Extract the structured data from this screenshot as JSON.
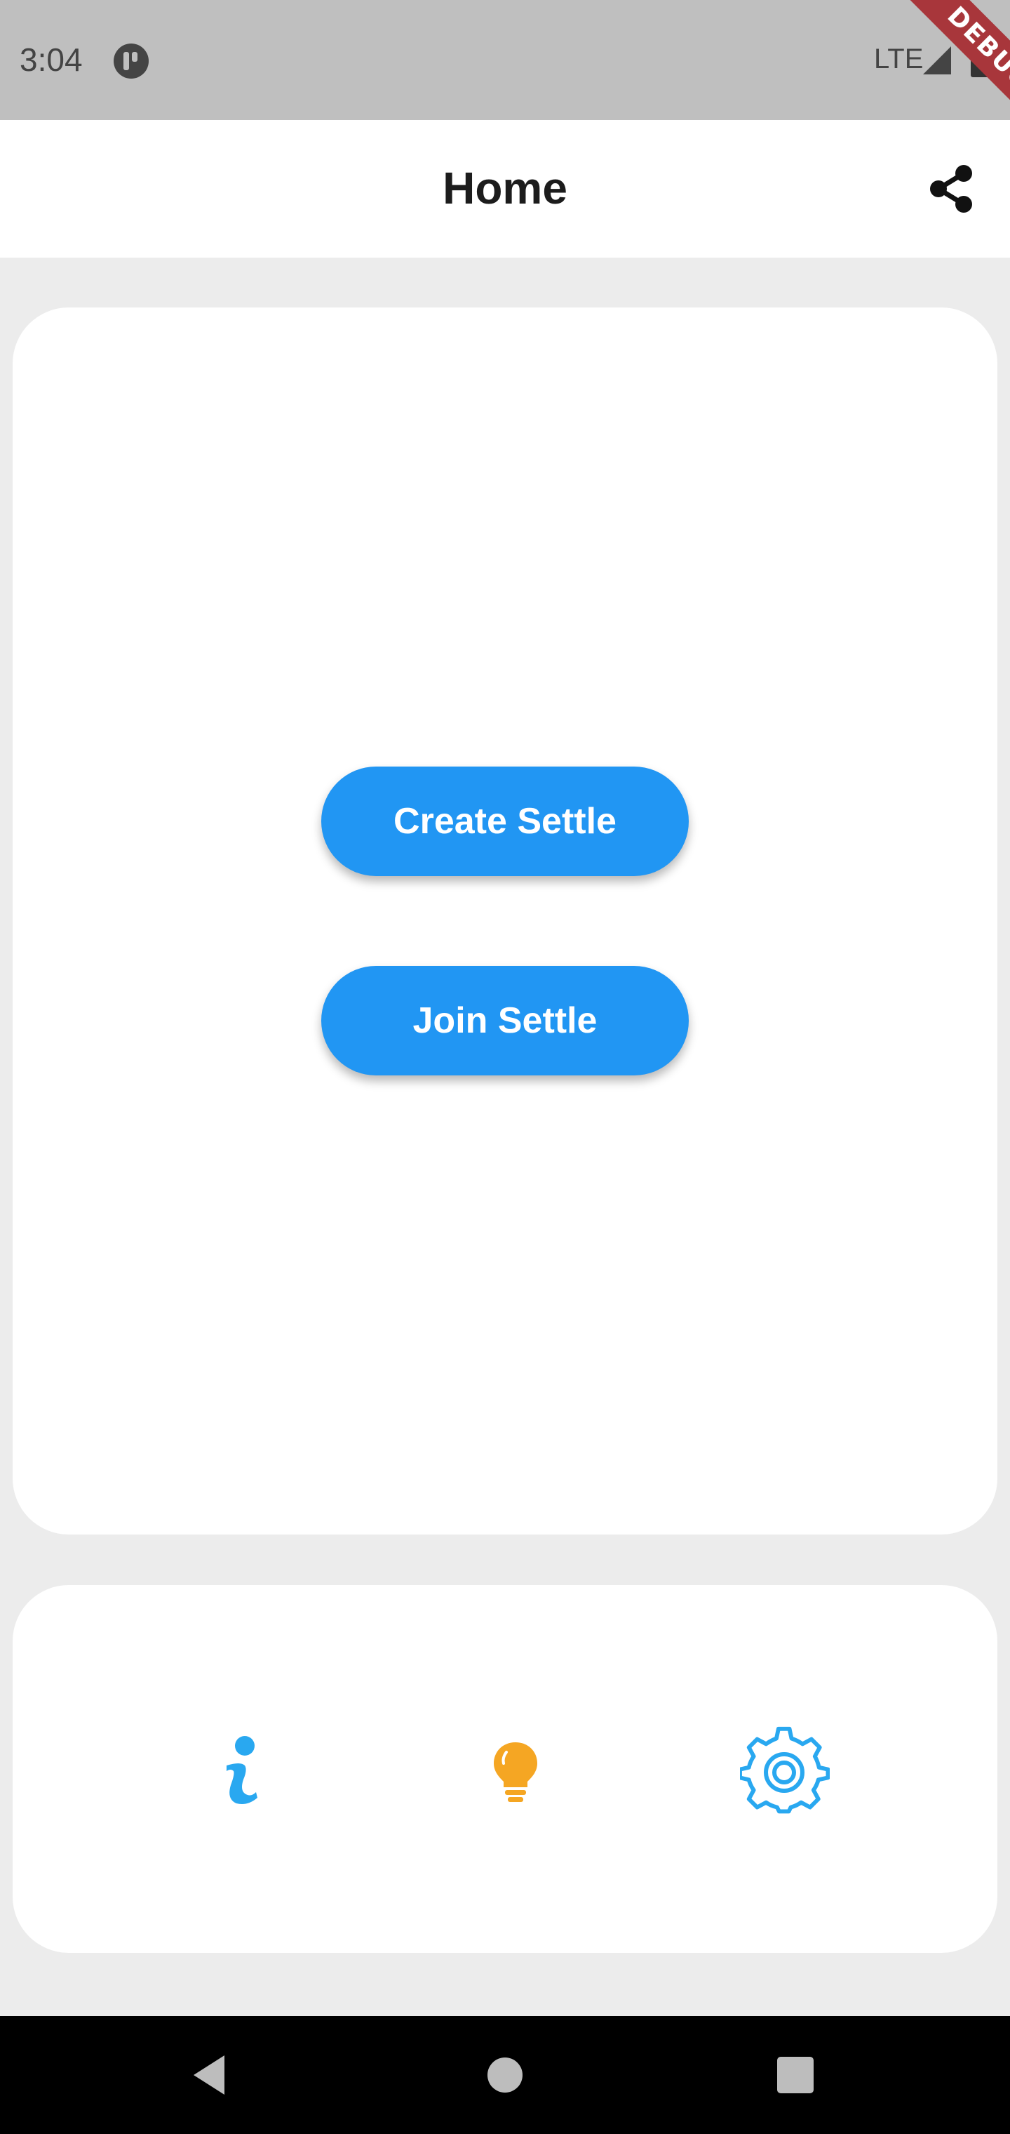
{
  "status_bar": {
    "time": "3:04",
    "network": "LTE",
    "debug_banner": "DEBUG"
  },
  "app_bar": {
    "title": "Home",
    "share_icon": "share-icon"
  },
  "main": {
    "create_label": "Create Settle",
    "join_label": "Join Settle"
  },
  "bottom_nav": {
    "icons": [
      "info-icon",
      "lightbulb-icon",
      "gear-icon"
    ]
  },
  "colors": {
    "primary": "#2196f3",
    "info": "#29a8f0",
    "bulb": "#f5a623",
    "background": "#ececec"
  }
}
